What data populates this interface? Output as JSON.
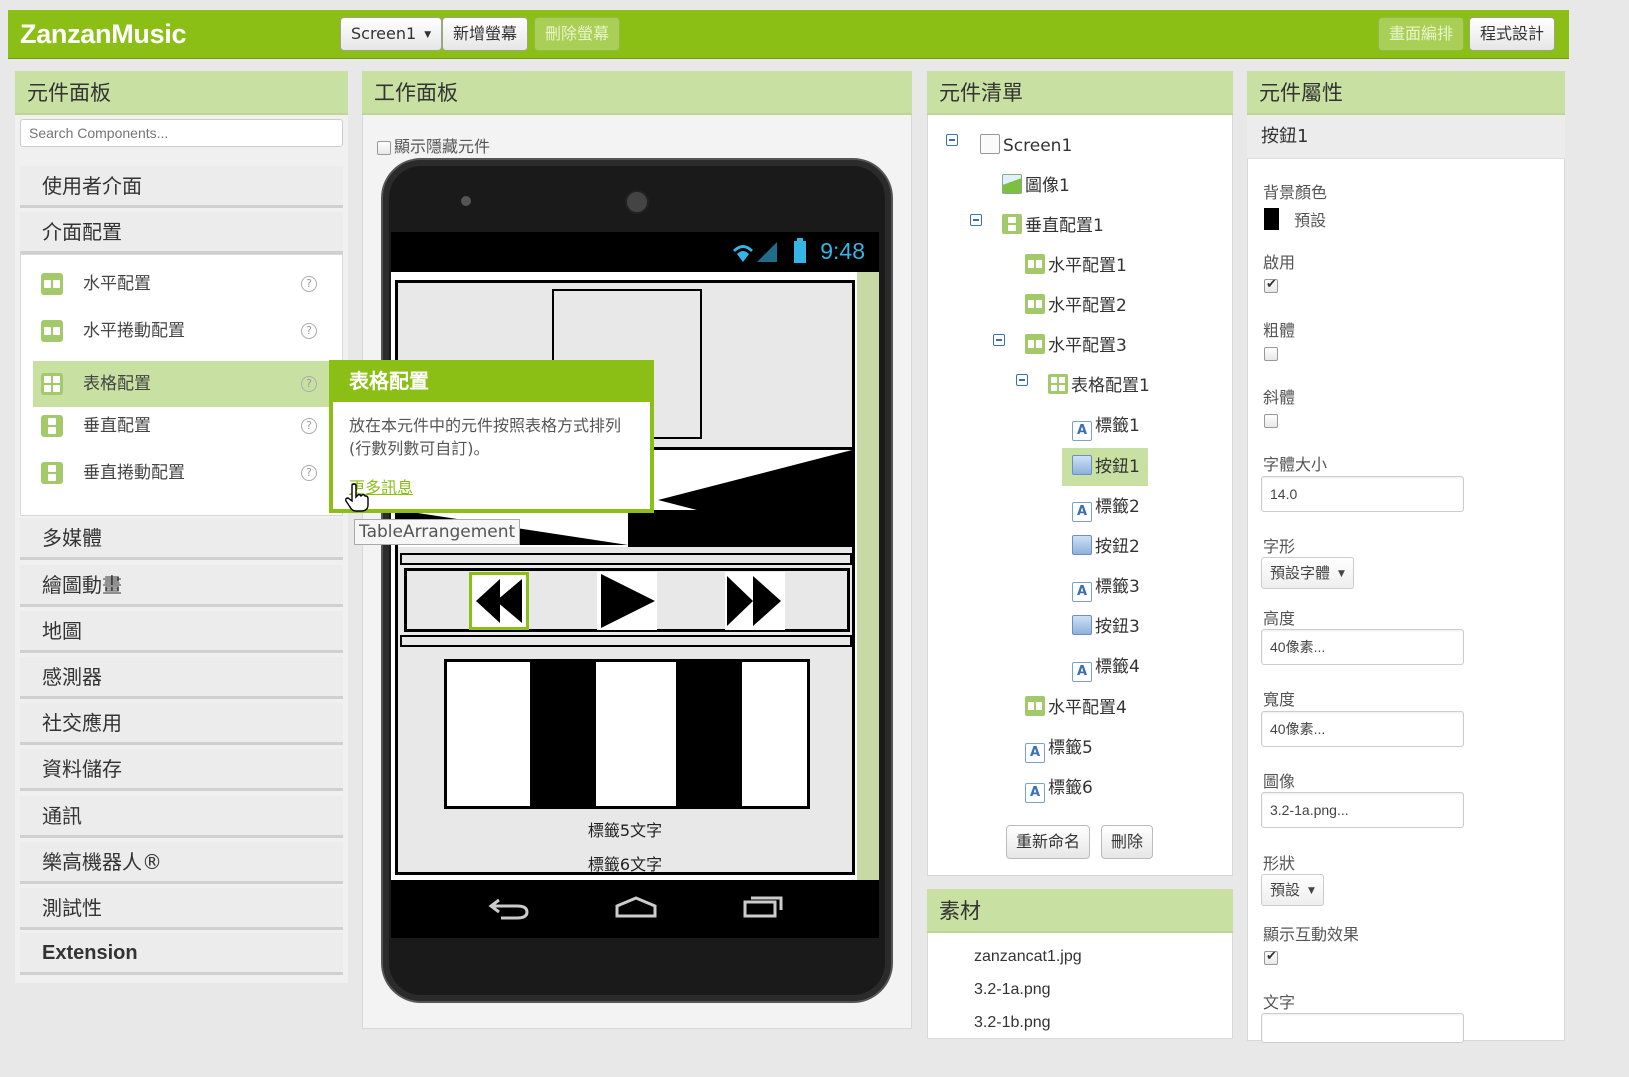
{
  "app": {
    "title": "ZanzanMusic",
    "screen_select": "Screen1",
    "add_screen": "新增螢幕",
    "remove_screen": "刪除螢幕",
    "designer": "畫面編排",
    "blocks": "程式設計"
  },
  "palette": {
    "header": "元件面板",
    "search_placeholder": "Search Components...",
    "categories_top": [
      "使用者介面",
      "介面配置"
    ],
    "layout_items": [
      "水平配置",
      "水平捲動配置",
      "表格配置",
      "垂直配置",
      "垂直捲動配置"
    ],
    "categories_bottom": [
      "多媒體",
      "繪圖動畫",
      "地圖",
      "感測器",
      "社交應用",
      "資料儲存",
      "通訊",
      "樂高機器人®",
      "測試性",
      "Extension"
    ]
  },
  "tooltip": {
    "title": "表格配置",
    "body": "放在本元件中的元件按照表格方式排列(行數列數可自訂)。",
    "more": "更多訊息",
    "hover_name": "TableArrangement"
  },
  "viewer": {
    "header": "工作面板",
    "show_hidden": "顯示隱藏元件",
    "clock": "9:48",
    "label5": "標籤5文字",
    "label6": "標籤6文字"
  },
  "tree": {
    "header": "元件清單",
    "nodes": [
      "Screen1",
      "圖像1",
      "垂直配置1",
      "水平配置1",
      "水平配置2",
      "水平配置3",
      "表格配置1",
      "標籤1",
      "按鈕1",
      "標籤2",
      "按鈕2",
      "標籤3",
      "按鈕3",
      "標籤4",
      "水平配置4",
      "標籤5",
      "標籤6"
    ],
    "rename": "重新命名",
    "delete": "刪除"
  },
  "media": {
    "header": "素材",
    "assets": [
      "zanzancat1.jpg",
      "3.2-1a.png",
      "3.2-1b.png"
    ]
  },
  "properties": {
    "header": "元件屬性",
    "component": "按鈕1",
    "bg_color_label": "背景顏色",
    "bg_color_value": "預設",
    "enabled_label": "啟用",
    "enabled": true,
    "bold_label": "粗體",
    "bold": false,
    "italic_label": "斜體",
    "italic": false,
    "font_size_label": "字體大小",
    "font_size": "14.0",
    "typeface_label": "字形",
    "typeface": "預設字體",
    "height_label": "高度",
    "height": "40像素...",
    "width_label": "寬度",
    "width": "40像素...",
    "image_label": "圖像",
    "image": "3.2-1a.png...",
    "shape_label": "形狀",
    "shape": "預設",
    "feedback_label": "顯示互動效果",
    "feedback": true,
    "text_label": "文字",
    "text": ""
  },
  "colors": {
    "accent": "#8bbf16",
    "header_bg": "#c8e1a2"
  }
}
